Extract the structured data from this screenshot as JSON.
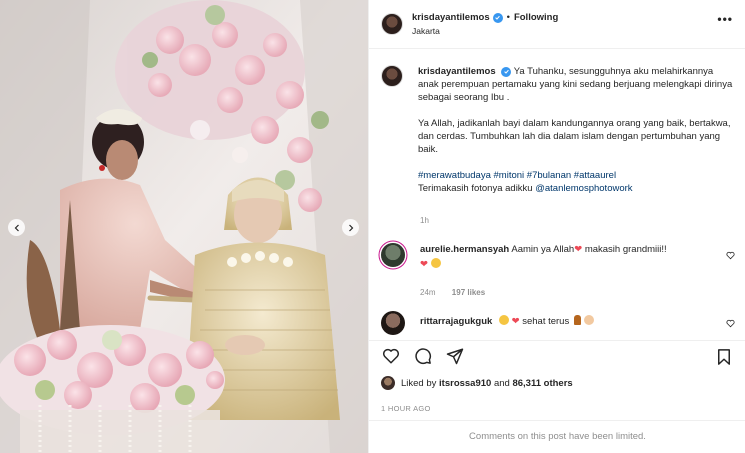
{
  "post": {
    "username": "krisdayantilemos",
    "follow_label": "Following",
    "separator": "•",
    "location": "Jakarta",
    "more_label": "•••"
  },
  "caption": {
    "username": "krisdayantilemos",
    "paragraph1": "Ya Tuhanku, sesungguhnya aku melahirkannya anak perempuan pertamaku yang kini sedang berjuang melengkapi dirinya sebagai seorang Ibu .",
    "paragraph2": "Ya Allah, jadikanlah bayi dalam kandungannya orang yang baik, bertakwa, dan cerdas. Tumbuhkan lah dia dalam islam dengan pertumbuhan yang baik.",
    "hashtags": "#merawatbudaya #mitoni #7bulanan #attaaurel",
    "thanks_prefix": "Terimakasih fotonya adikku ",
    "thanks_mention": "@atanlemosphotowork",
    "time": "1h"
  },
  "comments": [
    {
      "username": "aurelie.hermansyah",
      "text_before": "Aamin ya Allah",
      "text_after": " makasih grandmiii!!",
      "time": "24m",
      "likes": "197 likes"
    },
    {
      "username": "rittarrajagukguk",
      "text": "sehat terus"
    }
  ],
  "likes": {
    "prefix": "Liked by ",
    "user": "itsrossa910",
    "middle": " and ",
    "count": "86,311 others"
  },
  "posted_ago": "1 HOUR AGO",
  "comments_limited": "Comments on this post have been limited.",
  "colors": {
    "verified": "#3897f0",
    "link": "#00376b",
    "muted": "#8e8e8e",
    "heart": "#ed4956"
  },
  "icons": {
    "like": "heart-outline-icon",
    "comment": "comment-bubble-icon",
    "share": "paper-plane-icon",
    "save": "bookmark-icon"
  }
}
